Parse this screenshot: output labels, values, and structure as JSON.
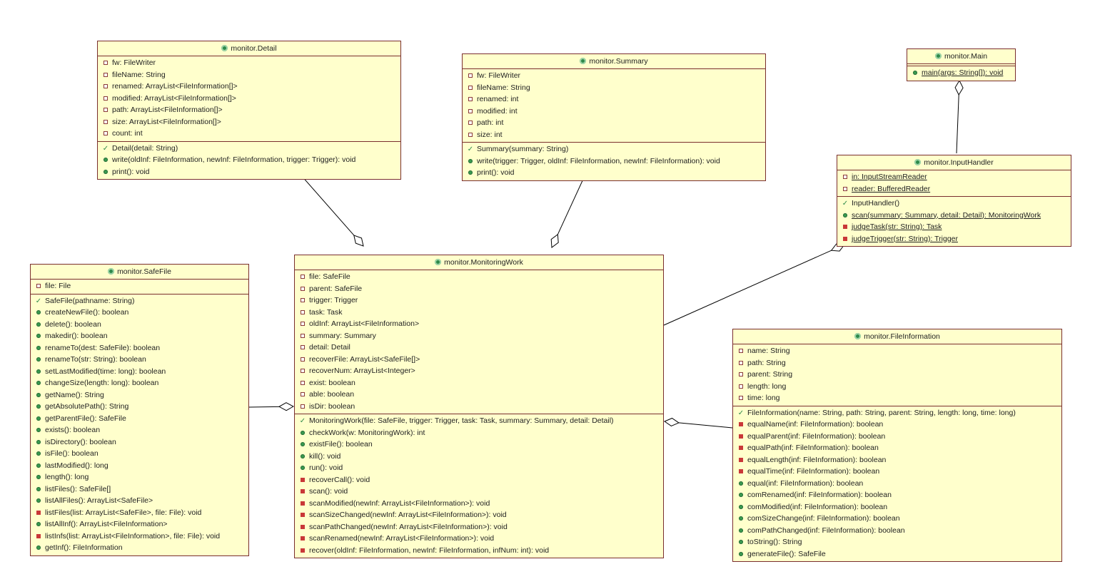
{
  "classes": {
    "detail": {
      "name": "monitor.Detail",
      "fields": [
        "fw: FileWriter",
        "fileName: String",
        "renamed: ArrayList<FileInformation[]>",
        "modified: ArrayList<FileInformation[]>",
        "path: ArrayList<FileInformation[]>",
        "size: ArrayList<FileInformation[]>",
        "count: int"
      ],
      "methods": [
        {
          "vis": "ctor",
          "text": "Detail(detail: String)"
        },
        {
          "vis": "public",
          "text": "write(oldInf: FileInformation, newInf: FileInformation, trigger: Trigger): void"
        },
        {
          "vis": "public",
          "text": "print(): void"
        }
      ]
    },
    "summary": {
      "name": "monitor.Summary",
      "fields": [
        "fw: FileWriter",
        "fileName: String",
        "renamed: int",
        "modified: int",
        "path: int",
        "size: int"
      ],
      "methods": [
        {
          "vis": "ctor",
          "text": "Summary(summary: String)"
        },
        {
          "vis": "public",
          "text": "write(trigger: Trigger, oldInf: FileInformation, newInf: FileInformation): void"
        },
        {
          "vis": "public",
          "text": "print(): void"
        }
      ]
    },
    "main": {
      "name": "monitor.Main",
      "fields": [],
      "methods": [
        {
          "vis": "public",
          "text": "main(args: String[]): void",
          "static": true
        }
      ]
    },
    "input_handler": {
      "name": "monitor.InputHandler",
      "fields": [
        {
          "text": "in: InputStreamReader",
          "static": true
        },
        {
          "text": "reader: BufferedReader",
          "static": true
        }
      ],
      "methods": [
        {
          "vis": "ctor",
          "text": "InputHandler()"
        },
        {
          "vis": "public",
          "text": "scan(summary: Summary, detail: Detail): MonitoringWork",
          "static": true
        },
        {
          "vis": "private",
          "text": "judgeTask(str: String): Task",
          "static": true
        },
        {
          "vis": "private",
          "text": "judgeTrigger(str: String): Trigger",
          "static": true
        }
      ]
    },
    "safe_file": {
      "name": "monitor.SafeFile",
      "fields": [
        "file: File"
      ],
      "methods": [
        {
          "vis": "ctor",
          "text": "SafeFile(pathname: String)"
        },
        {
          "vis": "public",
          "text": "createNewFile(): boolean"
        },
        {
          "vis": "public",
          "text": "delete(): boolean"
        },
        {
          "vis": "public",
          "text": "makedir(): boolean"
        },
        {
          "vis": "public",
          "text": "renameTo(dest: SafeFile): boolean"
        },
        {
          "vis": "public",
          "text": "renameTo(str: String): boolean"
        },
        {
          "vis": "public",
          "text": "setLastModified(time: long): boolean"
        },
        {
          "vis": "public",
          "text": "changeSize(length: long): boolean"
        },
        {
          "vis": "public",
          "text": "getName(): String"
        },
        {
          "vis": "public",
          "text": "getAbsolutePath(): String"
        },
        {
          "vis": "public",
          "text": "getParentFile(): SafeFile"
        },
        {
          "vis": "public",
          "text": "exists(): boolean"
        },
        {
          "vis": "public",
          "text": "isDirectory(): boolean"
        },
        {
          "vis": "public",
          "text": "isFile(): boolean"
        },
        {
          "vis": "public",
          "text": "lastModified(): long"
        },
        {
          "vis": "public",
          "text": "length(): long"
        },
        {
          "vis": "public",
          "text": "listFiles(): SafeFile[]"
        },
        {
          "vis": "public",
          "text": "listAllFiles(): ArrayList<SafeFile>"
        },
        {
          "vis": "private",
          "text": "listFiles(list: ArrayList<SafeFile>, file: File): void"
        },
        {
          "vis": "public",
          "text": "listAllInf(): ArrayList<FileInformation>"
        },
        {
          "vis": "private",
          "text": "listInfs(list: ArrayList<FileInformation>, file: File): void"
        },
        {
          "vis": "public",
          "text": "getInf(): FileInformation"
        }
      ]
    },
    "monitoring_work": {
      "name": "monitor.MonitoringWork",
      "fields": [
        "file: SafeFile",
        "parent: SafeFile",
        "trigger: Trigger",
        "task: Task",
        "oldInf: ArrayList<FileInformation>",
        "summary: Summary",
        "detail: Detail",
        "recoverFile: ArrayList<SafeFile[]>",
        "recoverNum: ArrayList<Integer>",
        "exist: boolean",
        "able: boolean",
        "isDir: boolean"
      ],
      "methods": [
        {
          "vis": "ctor",
          "text": "MonitoringWork(file: SafeFile, trigger: Trigger, task: Task, summary: Summary, detail: Detail)"
        },
        {
          "vis": "public",
          "text": "checkWork(w: MonitoringWork): int"
        },
        {
          "vis": "public",
          "text": "existFile(): boolean"
        },
        {
          "vis": "public",
          "text": "kill(): void"
        },
        {
          "vis": "public",
          "text": "run(): void"
        },
        {
          "vis": "private",
          "text": "recoverCall(): void"
        },
        {
          "vis": "private",
          "text": "scan(): void"
        },
        {
          "vis": "private",
          "text": "scanModified(newInf: ArrayList<FileInformation>): void"
        },
        {
          "vis": "private",
          "text": "scanSizeChanged(newInf: ArrayList<FileInformation>): void"
        },
        {
          "vis": "private",
          "text": "scanPathChanged(newInf: ArrayList<FileInformation>): void"
        },
        {
          "vis": "private",
          "text": "scanRenamed(newInf: ArrayList<FileInformation>): void"
        },
        {
          "vis": "private",
          "text": "recover(oldInf: FileInformation, newInf: FileInformation, infNum: int): void"
        }
      ]
    },
    "file_information": {
      "name": "monitor.FileInformation",
      "fields": [
        "name: String",
        "path: String",
        "parent: String",
        "length: long",
        "time: long"
      ],
      "methods": [
        {
          "vis": "ctor",
          "text": "FileInformation(name: String, path: String, parent: String, length: long, time: long)"
        },
        {
          "vis": "private",
          "text": "equalName(inf: FileInformation): boolean"
        },
        {
          "vis": "private",
          "text": "equalParent(inf: FileInformation): boolean"
        },
        {
          "vis": "private",
          "text": "equalPath(inf: FileInformation): boolean"
        },
        {
          "vis": "private",
          "text": "equalLength(inf: FileInformation): boolean"
        },
        {
          "vis": "private",
          "text": "equalTime(inf: FileInformation): boolean"
        },
        {
          "vis": "public",
          "text": "equal(inf: FileInformation): boolean"
        },
        {
          "vis": "public",
          "text": "comRenamed(inf: FileInformation): boolean"
        },
        {
          "vis": "public",
          "text": "comModified(inf: FileInformation): boolean"
        },
        {
          "vis": "public",
          "text": "comSizeChange(inf: FileInformation): boolean"
        },
        {
          "vis": "public",
          "text": "comPathChanged(inf: FileInformation): boolean"
        },
        {
          "vis": "public",
          "text": "toString(): String"
        },
        {
          "vis": "public",
          "text": "generateFile(): SafeFile"
        }
      ]
    }
  },
  "relations": [
    {
      "from": "detail",
      "to": "monitoring_work",
      "type": "aggregation"
    },
    {
      "from": "summary",
      "to": "monitoring_work",
      "type": "aggregation"
    },
    {
      "from": "main",
      "to": "input_handler",
      "type": "aggregation"
    },
    {
      "from": "input_handler",
      "to": "monitoring_work",
      "type": "aggregation"
    },
    {
      "from": "safe_file",
      "to": "monitoring_work",
      "type": "aggregation"
    },
    {
      "from": "file_information",
      "to": "monitoring_work",
      "type": "aggregation"
    }
  ],
  "colors": {
    "class_fill": "#ffffcc",
    "class_border": "#7a2e2e",
    "public_icon": "#3a9a50",
    "private_icon": "#c93838",
    "line": "#000000"
  }
}
